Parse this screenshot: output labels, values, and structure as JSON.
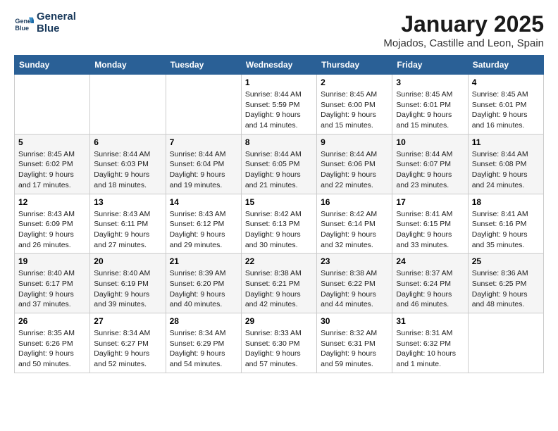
{
  "logo": {
    "line1": "General",
    "line2": "Blue"
  },
  "title": "January 2025",
  "location": "Mojados, Castille and Leon, Spain",
  "days_of_week": [
    "Sunday",
    "Monday",
    "Tuesday",
    "Wednesday",
    "Thursday",
    "Friday",
    "Saturday"
  ],
  "weeks": [
    [
      {
        "day": "",
        "content": ""
      },
      {
        "day": "",
        "content": ""
      },
      {
        "day": "",
        "content": ""
      },
      {
        "day": "1",
        "content": "Sunrise: 8:44 AM\nSunset: 5:59 PM\nDaylight: 9 hours\nand 14 minutes."
      },
      {
        "day": "2",
        "content": "Sunrise: 8:45 AM\nSunset: 6:00 PM\nDaylight: 9 hours\nand 15 minutes."
      },
      {
        "day": "3",
        "content": "Sunrise: 8:45 AM\nSunset: 6:01 PM\nDaylight: 9 hours\nand 15 minutes."
      },
      {
        "day": "4",
        "content": "Sunrise: 8:45 AM\nSunset: 6:01 PM\nDaylight: 9 hours\nand 16 minutes."
      }
    ],
    [
      {
        "day": "5",
        "content": "Sunrise: 8:45 AM\nSunset: 6:02 PM\nDaylight: 9 hours\nand 17 minutes."
      },
      {
        "day": "6",
        "content": "Sunrise: 8:44 AM\nSunset: 6:03 PM\nDaylight: 9 hours\nand 18 minutes."
      },
      {
        "day": "7",
        "content": "Sunrise: 8:44 AM\nSunset: 6:04 PM\nDaylight: 9 hours\nand 19 minutes."
      },
      {
        "day": "8",
        "content": "Sunrise: 8:44 AM\nSunset: 6:05 PM\nDaylight: 9 hours\nand 21 minutes."
      },
      {
        "day": "9",
        "content": "Sunrise: 8:44 AM\nSunset: 6:06 PM\nDaylight: 9 hours\nand 22 minutes."
      },
      {
        "day": "10",
        "content": "Sunrise: 8:44 AM\nSunset: 6:07 PM\nDaylight: 9 hours\nand 23 minutes."
      },
      {
        "day": "11",
        "content": "Sunrise: 8:44 AM\nSunset: 6:08 PM\nDaylight: 9 hours\nand 24 minutes."
      }
    ],
    [
      {
        "day": "12",
        "content": "Sunrise: 8:43 AM\nSunset: 6:09 PM\nDaylight: 9 hours\nand 26 minutes."
      },
      {
        "day": "13",
        "content": "Sunrise: 8:43 AM\nSunset: 6:11 PM\nDaylight: 9 hours\nand 27 minutes."
      },
      {
        "day": "14",
        "content": "Sunrise: 8:43 AM\nSunset: 6:12 PM\nDaylight: 9 hours\nand 29 minutes."
      },
      {
        "day": "15",
        "content": "Sunrise: 8:42 AM\nSunset: 6:13 PM\nDaylight: 9 hours\nand 30 minutes."
      },
      {
        "day": "16",
        "content": "Sunrise: 8:42 AM\nSunset: 6:14 PM\nDaylight: 9 hours\nand 32 minutes."
      },
      {
        "day": "17",
        "content": "Sunrise: 8:41 AM\nSunset: 6:15 PM\nDaylight: 9 hours\nand 33 minutes."
      },
      {
        "day": "18",
        "content": "Sunrise: 8:41 AM\nSunset: 6:16 PM\nDaylight: 9 hours\nand 35 minutes."
      }
    ],
    [
      {
        "day": "19",
        "content": "Sunrise: 8:40 AM\nSunset: 6:17 PM\nDaylight: 9 hours\nand 37 minutes."
      },
      {
        "day": "20",
        "content": "Sunrise: 8:40 AM\nSunset: 6:19 PM\nDaylight: 9 hours\nand 39 minutes."
      },
      {
        "day": "21",
        "content": "Sunrise: 8:39 AM\nSunset: 6:20 PM\nDaylight: 9 hours\nand 40 minutes."
      },
      {
        "day": "22",
        "content": "Sunrise: 8:38 AM\nSunset: 6:21 PM\nDaylight: 9 hours\nand 42 minutes."
      },
      {
        "day": "23",
        "content": "Sunrise: 8:38 AM\nSunset: 6:22 PM\nDaylight: 9 hours\nand 44 minutes."
      },
      {
        "day": "24",
        "content": "Sunrise: 8:37 AM\nSunset: 6:24 PM\nDaylight: 9 hours\nand 46 minutes."
      },
      {
        "day": "25",
        "content": "Sunrise: 8:36 AM\nSunset: 6:25 PM\nDaylight: 9 hours\nand 48 minutes."
      }
    ],
    [
      {
        "day": "26",
        "content": "Sunrise: 8:35 AM\nSunset: 6:26 PM\nDaylight: 9 hours\nand 50 minutes."
      },
      {
        "day": "27",
        "content": "Sunrise: 8:34 AM\nSunset: 6:27 PM\nDaylight: 9 hours\nand 52 minutes."
      },
      {
        "day": "28",
        "content": "Sunrise: 8:34 AM\nSunset: 6:29 PM\nDaylight: 9 hours\nand 54 minutes."
      },
      {
        "day": "29",
        "content": "Sunrise: 8:33 AM\nSunset: 6:30 PM\nDaylight: 9 hours\nand 57 minutes."
      },
      {
        "day": "30",
        "content": "Sunrise: 8:32 AM\nSunset: 6:31 PM\nDaylight: 9 hours\nand 59 minutes."
      },
      {
        "day": "31",
        "content": "Sunrise: 8:31 AM\nSunset: 6:32 PM\nDaylight: 10 hours\nand 1 minute."
      },
      {
        "day": "",
        "content": ""
      }
    ]
  ]
}
